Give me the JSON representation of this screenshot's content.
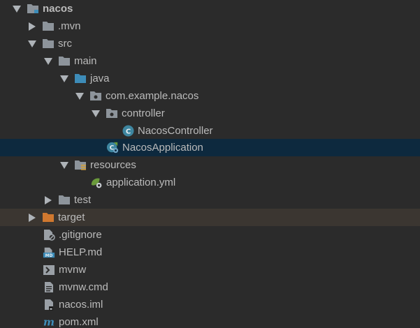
{
  "project_tree": {
    "root": {
      "label": "nacos"
    },
    "mvn": {
      "label": ".mvn"
    },
    "src": {
      "label": "src"
    },
    "main": {
      "label": "main"
    },
    "java": {
      "label": "java"
    },
    "package": {
      "label": "com.example.nacos"
    },
    "controller": {
      "label": "controller"
    },
    "nacos_controller": {
      "label": "NacosController"
    },
    "nacos_application": {
      "label": "NacosApplication"
    },
    "resources": {
      "label": "resources"
    },
    "application_yml": {
      "label": "application.yml"
    },
    "test": {
      "label": "test"
    },
    "target": {
      "label": "target"
    },
    "gitignore": {
      "label": ".gitignore"
    },
    "help_md": {
      "label": "HELP.md"
    },
    "mvnw": {
      "label": "mvnw"
    },
    "mvnw_cmd": {
      "label": "mvnw.cmd"
    },
    "nacos_iml": {
      "label": "nacos.iml"
    },
    "pom_xml": {
      "label": "pom.xml"
    }
  },
  "colors": {
    "background": "#2b2b2b",
    "selection": "#0d293e",
    "excluded_row": "#3b3631",
    "text": "#bbbbbb",
    "folder": "#8d949b",
    "source_folder": "#3d8cb8",
    "excluded_folder": "#d0782f"
  }
}
